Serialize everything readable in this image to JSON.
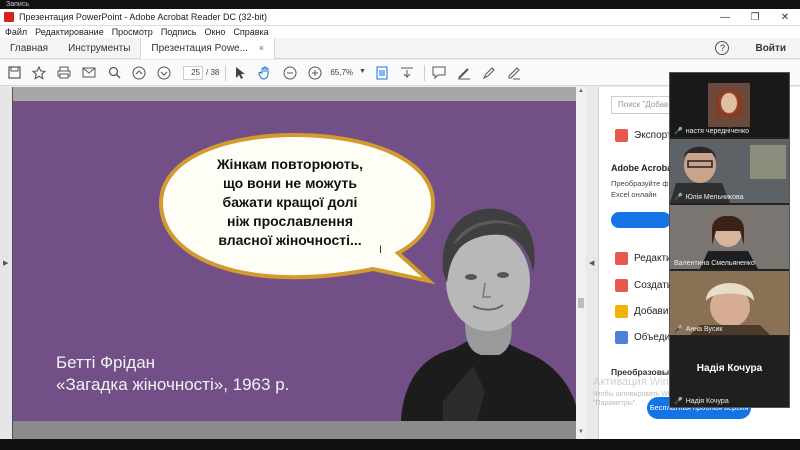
{
  "recording_label": "Запись",
  "window": {
    "title": "Презентация PowerPoint - Adobe Acrobat Reader DC (32-bit)",
    "controls": [
      "—",
      "❐",
      "✕"
    ]
  },
  "menu": [
    "Файл",
    "Редактирование",
    "Просмотр",
    "Подпись",
    "Окно",
    "Справка"
  ],
  "tabs": {
    "home": "Главная",
    "tools": "Инструменты",
    "document": "Презентация Powe...",
    "close": "×"
  },
  "help_label": "?",
  "signin_label": "Войти",
  "toolbar": {
    "page_current": "25",
    "page_total": "/ 38",
    "zoom": "65,7%"
  },
  "slide": {
    "quote_lines": [
      "Жінкам повторюють,",
      "що вони не можуть",
      "бажати кращої долі",
      "ніж прославлення",
      "власної жіночності..."
    ],
    "caption_line1": "Бетті Фрідан",
    "caption_line2": "«Загадка жіночності», 1963 р.",
    "colors": {
      "background": "#724f87",
      "bubble_border": "#d29a2f"
    }
  },
  "tools_pane": {
    "search_placeholder": "Поиск \"Добав",
    "export": "Экспорт",
    "acrobat_title": "Adobe Acrobat",
    "acrobat_desc_lines": [
      "Преобразуйте ф",
      "Excel онлайн"
    ],
    "edit": "Редакти",
    "create": "Создать",
    "add": "Добавит",
    "combine": "Объеди",
    "convert": "Преобразовы",
    "trial_btn": "Бесплатная пробная версия"
  },
  "activation": {
    "title": "Активация Windows",
    "sub_line1": "Чтобы активировать Windows, перейдите в раздел",
    "sub_line2": "\"Параметры\"."
  },
  "participants": [
    {
      "name": "настя чередніченко",
      "muted": true
    },
    {
      "name": "Юлія Мельникова",
      "muted": true
    },
    {
      "name": "Валентина Смельяненко",
      "muted": false
    },
    {
      "name": "Анна Вусик",
      "muted": true
    },
    {
      "name": "Надія Кочура",
      "muted": true,
      "speaker_title": "Надія Кочура"
    }
  ]
}
